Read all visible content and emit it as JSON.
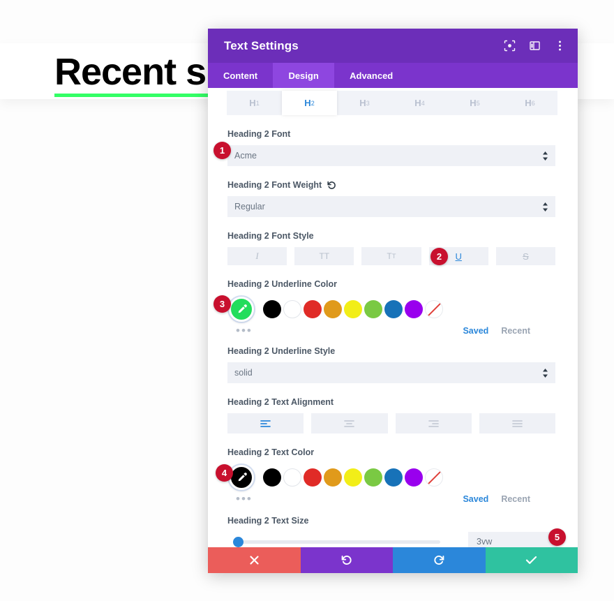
{
  "background": {
    "heading_text": "Recent shot",
    "heading_underline_color": "#33ff66"
  },
  "modal": {
    "title": "Text Settings",
    "titlebar_icons": [
      {
        "name": "focus-icon"
      },
      {
        "name": "layout-panel-icon"
      },
      {
        "name": "more-vertical-icon"
      }
    ],
    "tabs": [
      {
        "label": "Content",
        "active": false
      },
      {
        "label": "Design",
        "active": true
      },
      {
        "label": "Advanced",
        "active": false
      }
    ],
    "heading_level_tabs": [
      {
        "label": "H",
        "sub": "1",
        "active": false
      },
      {
        "label": "H",
        "sub": "2",
        "active": true
      },
      {
        "label": "H",
        "sub": "3",
        "active": false
      },
      {
        "label": "H",
        "sub": "4",
        "active": false
      },
      {
        "label": "H",
        "sub": "5",
        "active": false
      },
      {
        "label": "H",
        "sub": "6",
        "active": false
      }
    ],
    "fields": {
      "font": {
        "label": "Heading 2 Font",
        "value": "Acme"
      },
      "font_weight": {
        "label": "Heading 2 Font Weight",
        "value": "Regular",
        "has_reset": true
      },
      "font_style": {
        "label": "Heading 2 Font Style",
        "buttons": [
          {
            "glyph": "I",
            "name": "italic",
            "active": false
          },
          {
            "glyph": "TT",
            "name": "uppercase",
            "active": false
          },
          {
            "glyph": "TT",
            "name": "capitalize",
            "active": false
          },
          {
            "glyph": "U",
            "name": "underline",
            "active": true
          },
          {
            "glyph": "S",
            "name": "strikethrough",
            "active": false
          }
        ]
      },
      "underline_color": {
        "label": "Heading 2 Underline Color",
        "selected": "#22dd5c",
        "swatches": [
          "#000000",
          "#ffffff",
          "#e02b27",
          "#e09a1b",
          "#f2ee18",
          "#7ac943",
          "#1772b8",
          "#9900ee",
          "none"
        ],
        "more_label": "•••",
        "palette_tabs": [
          {
            "label": "Saved",
            "active": true
          },
          {
            "label": "Recent",
            "active": false
          }
        ]
      },
      "underline_style": {
        "label": "Heading 2 Underline Style",
        "value": "solid"
      },
      "text_alignment": {
        "label": "Heading 2 Text Alignment",
        "buttons": [
          {
            "name": "align-left",
            "active": true
          },
          {
            "name": "align-center",
            "active": false
          },
          {
            "name": "align-right",
            "active": false
          },
          {
            "name": "align-justify",
            "active": false
          }
        ]
      },
      "text_color": {
        "label": "Heading 2 Text Color",
        "selected": "#000000",
        "swatches": [
          "#000000",
          "#ffffff",
          "#e02b27",
          "#e09a1b",
          "#f2ee18",
          "#7ac943",
          "#1772b8",
          "#9900ee",
          "none"
        ],
        "more_label": "•••",
        "palette_tabs": [
          {
            "label": "Saved",
            "active": true
          },
          {
            "label": "Recent",
            "active": false
          }
        ]
      },
      "text_size": {
        "label": "Heading 2 Text Size",
        "value": "3vw",
        "slider_percent": 2
      }
    },
    "footer_buttons": [
      {
        "name": "cancel-button",
        "icon": "close-icon",
        "color": "#eb5d5a"
      },
      {
        "name": "undo-button",
        "icon": "undo-icon",
        "color": "#7b34cc"
      },
      {
        "name": "redo-button",
        "icon": "redo-icon",
        "color": "#2b87da"
      },
      {
        "name": "save-button",
        "icon": "check-icon",
        "color": "#2fc2a0"
      }
    ]
  },
  "annotations": [
    {
      "number": "1"
    },
    {
      "number": "2"
    },
    {
      "number": "3"
    },
    {
      "number": "4"
    },
    {
      "number": "5"
    }
  ]
}
